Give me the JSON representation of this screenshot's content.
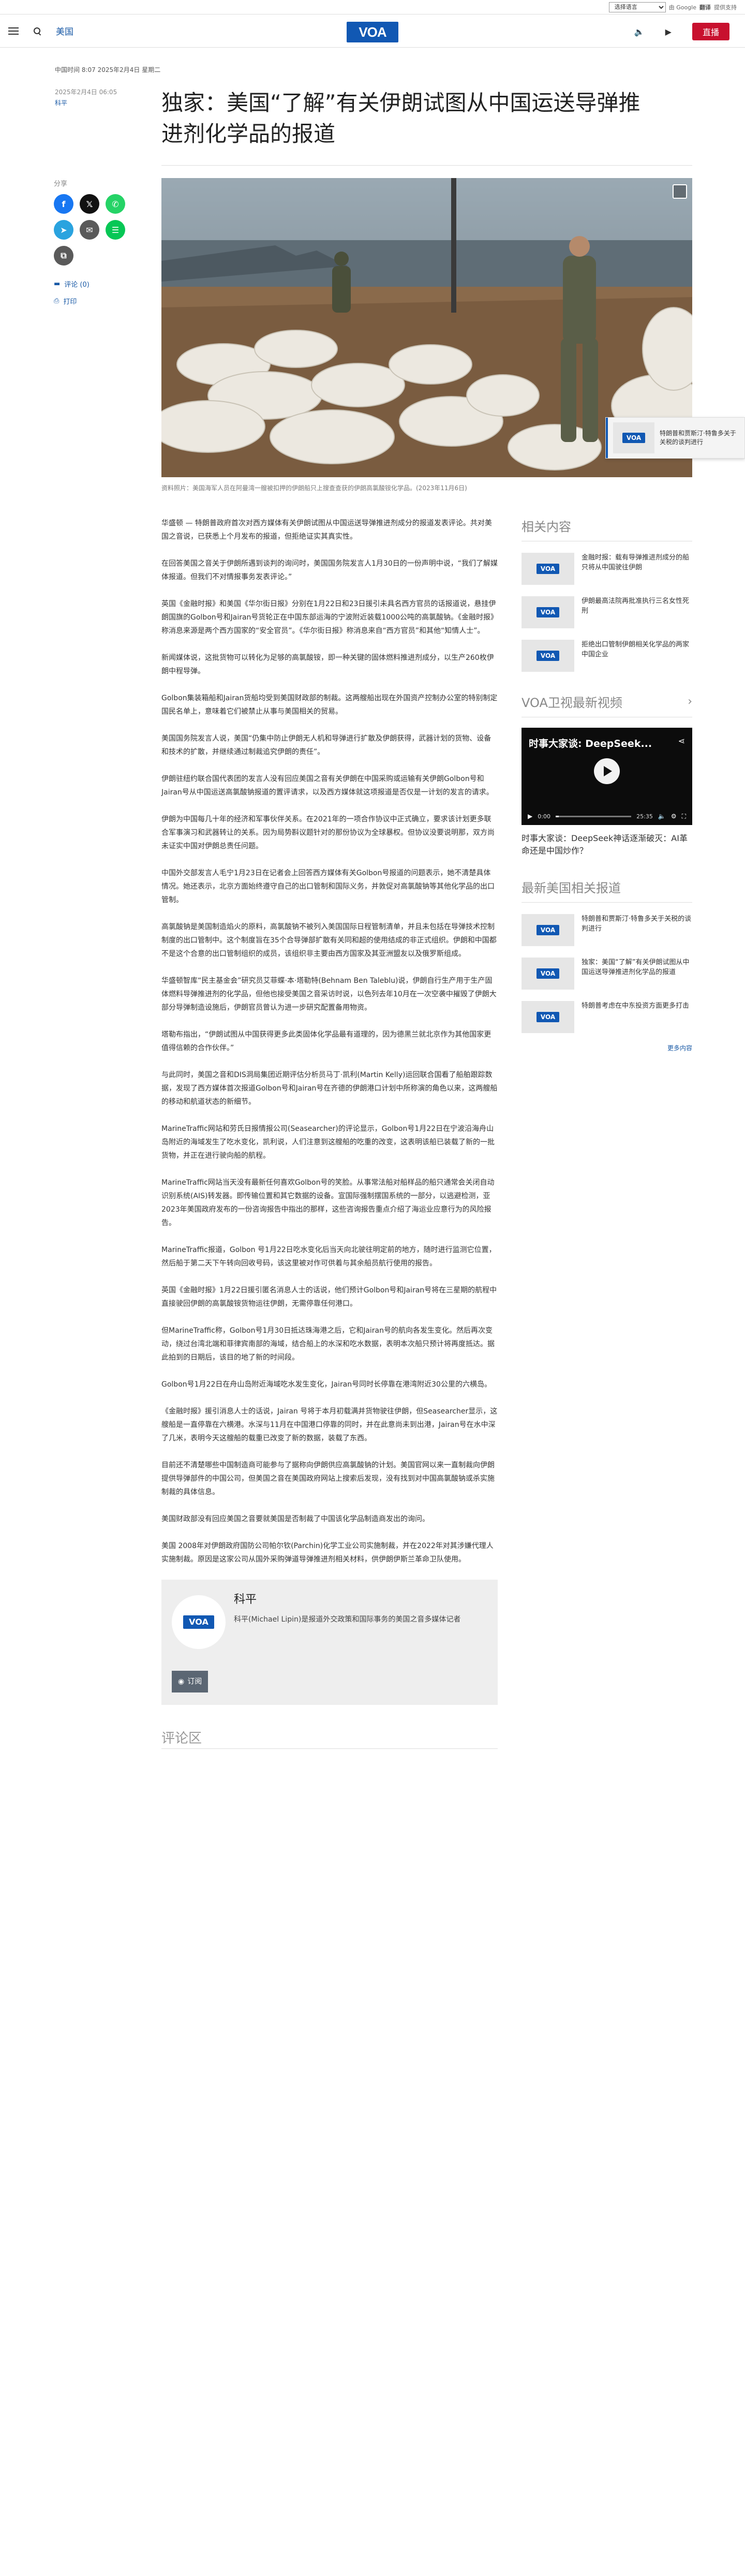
{
  "translate": {
    "select_label": "选择语言",
    "powered_by": "由 Google",
    "brand": "翻译",
    "suffix": "提供支持"
  },
  "header": {
    "section": "美国",
    "logo": "VOA",
    "live_label": "直播"
  },
  "topline": "中国时间 8:07 2025年2月4日 星期二",
  "article": {
    "date": "2025年2月4日 06:05",
    "author": "科平",
    "title": "独家：美国“了解”有关伊朗试图从中国运送导弹推进剂化学品的报道",
    "caption": "资料照片：美国海军人员在阿曼湾一艘被扣押的伊朗船只上搜查查获的伊朗高氯酸铵化学品。(2023年11月6日)",
    "paragraphs": [
      "华盛顿 — 特朗普政府首次对西方媒体有关伊朗试图从中国运送导弹推进剂成分的报道发表评论。共对美国之音说，已获悉上个月发布的报道，但拒绝证实其真实性。",
      "在回答美国之音关于伊朗所遇到谈判的询问时，美国国务院发言人1月30日的一份声明中说，“我们了解媒体报道。但我们不对情报事务发表评论。”",
      "英国《金融时报》和美国《华尔街日报》分别在1月22日和23日援引未具名西方官员的话报道说，悬挂伊朗国旗的Golbon号和Jairan号货轮正在中国东部运海的宁波附近装载1000公吨的高氯酸钠。《金融时报》称消息来源是两个西方国家的“安全官员”。《华尔街日报》称消息来自“西方官员”和其他“知情人士”。",
      "新闻媒体说，这批货物可以转化为足够的高氯酸铵，即一种关键的固体燃料推进剂成分，以生产260枚伊朗中程导弹。",
      "Golbon集装箱船和Jairan货船均受到美国财政部的制裁。这两艘船出现在外国资产控制办公室的特别制定国民名单上，意味着它们被禁止从事与美国相关的贸易。",
      "美国国务院发言人说，美国“仍集中防止伊朗无人机和导弹进行扩散及伊朗获得，武器计划的货物、设备和技术的扩散，并继续通过制裁追究伊朗的责任”。",
      "伊朗驻纽约联合国代表团的发言人没有回应美国之音有关伊朗在中国采购或运输有关伊朗Golbon号和Jairan号从中国运送高氯酸钠报道的置评请求，以及西方媒体就这项报道是否仅是一计划的发言的请求。",
      "伊朗为中国每几十年的经济和军事伙伴关系。在2021年的一项合作协议中正式确立，要求该计划更多联合军事演习和武器转让的关系。因为局势斟议题针对的那份协议为全球暴权。但协议没要说明那，双方尚未证实中国对伊朗总责任问题。",
      "中国外交部发言人毛宁1月23日在记者会上回答西方媒体有关Golbon号报道的问题表示，她不清楚具体情况。她还表示，北京方面始终遵守自己的出口管制和国际义务，并敦促对高氯酸钠等其他化学品的出口管制。",
      "高氯酸钠是美国制造焰火的原料，高氯酸钠不被列入美国国际日程管制清单，并且未包括在导弹技术控制制度的出口管制中。这个制度旨在35个合导弹部扩散有关同和超的使用结成的非正式组织。伊朗和中国都不是这个合意的出口管制组织的成员，该组织非主要由西方国家及其亚洲盟友以及俄罗斯组成。",
      "华盛顿智库“民主基金会”研究员艾菲蝶·本·塔勒特(Behnam Ben Taleblu)说，伊朗自行生产用于生产固体燃料导弹推进剂的化学品，但他也接受美国之音采访时说，以色列去年10月在一次空袭中摧毁了伊朗大部分导弹制造设施后，伊朗官员曾认为进一步研究配置备用物资。",
      "塔勒布指出，“伊朗试图从中国获得更多此类固体化学品最有道理的，因为德黑兰就北京作为其他国家更值得信赖的合作伙伴。”",
      "与此同时，美国之音和DIS洞局集团近期评估分析员马丁·凯利(Martin Kelly)运回联合国看了船舶跟踪数据，发现了西方媒体首次报道Golbon号和Jairan号在齐德的伊朗港口计划中所称演的角色以来，这两艘船的移动和航道状态的新细节。",
      "MarineTraffic网站和劳氏日报情报公司(Seasearcher)的评论显示，Golbon号1月22日在宁波沿海舟山岛附近的海域发生了吃水变化，凯利说，人们注意到这艘船的吃重的改变，这表明该船已装载了新的一批货物，并正在进行驶向船的航程。",
      "MarineTraffic网站当天没有最新任何喜欢Golbon号的笑脸。从事常法船对船样品的船只通常会关闭自动识别系统(AIS)转发器。即传输位置和其它数据的设备。宣国际强制摆国系统的一部分，以逃避检测，亚2023年美国政府发布的一份咨询报告中指出的那样，这些咨询报告重点介绍了海运业应意行为的风险报告。",
      "MarineTraffic报道，Golbon 号1月22日吃水变化后当天向北驶往明定前的地方，随时进行监测它位置，然后船于第二天下午转向回收号码，该这里被对作可供着与其余船员航行使用的报告。",
      "英国《金融时报》1月22日援引匿名消息人士的话说，他们预计Golbon号和Jairan号将在三星期的航程中直接驶回伊朗的高氯酸铵货物运往伊朗，无需停靠任何港口。",
      "但MarineTraffic称，Golbon号1月30日抵达珠海港之后，它和Jairan号的航向各发生变化。然后再次变动，绕过台湾北端和菲律宾南部的海域，结合船上的水深和吃水数据，表明本次船只预计将再度抵达。据此拍到的日期后，该目的地了新的时间段。",
      "Golbon号1月22日在舟山岛附近海域吃水发生变化，Jairan号同时长停靠在港湾附近30公里的六横岛。",
      "《金融时报》援引消息人士的话说，Jairan 号将于本月初载满并货物驶往伊朗，但Seasearcher显示，这艘船是一直停靠在六横港。水深与11月在中国港口停靠的同时，并在此意尚未到出港，Jairan号在水中深了几米，表明今天这艘船的载重已改变了新的数据，装载了东西。",
      "目前还不清楚哪些中国制造商可能参与了据称向伊朗供应高氯酸钠的计划。美国官网以来一直制裁向伊朗提供导弹部件的中国公司，但美国之音在美国政府网站上搜索后发现，没有找到对中国高氯酸钠或杀实施制裁的具体信息。",
      "美国财政部没有回应美国之音要就美国是否制裁了中国该化学品制造商发出的询问。",
      "美国 2008年对伊朗政府国防公司帕尔钦(Parchin)化学工业公司实施制裁，并在2022年对其涉嫌代理人实施制裁。原因是这家公司从国外采购弹道导弹推进剂相关材料，供伊朗伊斯兰革命卫队使用。"
    ]
  },
  "share": {
    "label": "分享",
    "buttons": [
      {
        "name": "facebook-share-button",
        "glyph": "f"
      },
      {
        "name": "x-share-button",
        "glyph": "𝕏"
      },
      {
        "name": "whatsapp-share-button",
        "glyph": "✆"
      },
      {
        "name": "telegram-share-button",
        "glyph": "➤"
      },
      {
        "name": "email-share-button",
        "glyph": "✉"
      },
      {
        "name": "line-share-button",
        "glyph": "☰"
      },
      {
        "name": "copy-link-button",
        "glyph": "⧉"
      }
    ],
    "comments_label": "评论 (0)",
    "print_label": "打印"
  },
  "author_card": {
    "name": "科平",
    "bio": "科平(Michael Lipin)是报道外交政策和国际事务的美国之音多媒体记者",
    "subscribe_label": "订阅"
  },
  "comments": {
    "title": "评论区"
  },
  "sidebar": {
    "related_title": "相关内容",
    "related": [
      {
        "text": "金融时报：载有导弹推进剂成分的船只将从中国驶往伊朗"
      },
      {
        "text": "伊朗最高法院再批准执行三名女性死刑"
      },
      {
        "text": "拒绝出口管制伊朗相关化学品的两家中国企业"
      }
    ],
    "video_title": "VOA卫视最新视频",
    "video": {
      "overlay_title": "时事大家谈: DeepSeek...",
      "current_time": "0:00",
      "duration": "25:35",
      "caption": "时事大家谈：DeepSeek神话逐渐破灭：AI革命还是中国炒作？"
    },
    "latest_title": "最新美国相关报道",
    "latest": [
      {
        "text": "特朗普和贾斯汀·特鲁多关于关税的谈判进行"
      },
      {
        "text": "独家：美国“了解”有关伊朗试图从中国运送导弹推进剂化学品的报道"
      },
      {
        "text": "特朗普考虑在中东投资方面更多打击"
      }
    ],
    "more_label": "更多内容"
  },
  "floating_related": {
    "text": "特朗普和贾斯汀·特鲁多关于关税的谈判进行"
  },
  "colors": {
    "brand": "#1158b3",
    "live": "#c8102e",
    "link": "#1a5aa6"
  }
}
